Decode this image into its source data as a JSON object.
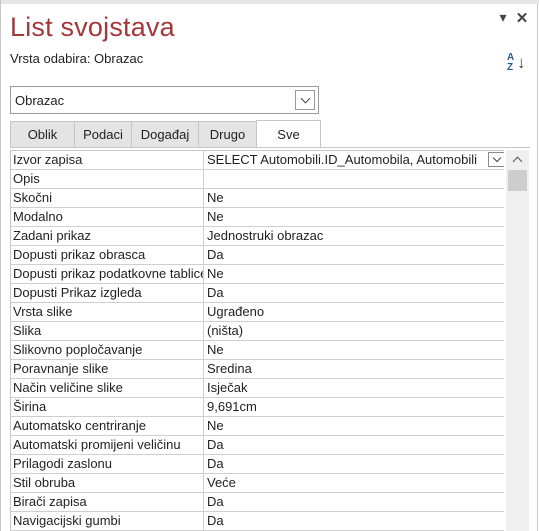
{
  "panel": {
    "title": "List svojstava",
    "selection_type": "Vrsta odabira:  Obrazac",
    "controls": {
      "dropdown_icon": "▾",
      "close_icon": "✕"
    },
    "sort": {
      "a": "A",
      "z": "Z",
      "arrow": "↓"
    }
  },
  "object_selector": {
    "value": "Obrazac"
  },
  "tabs": [
    {
      "label": "Oblik"
    },
    {
      "label": "Podaci"
    },
    {
      "label": "Događaj"
    },
    {
      "label": "Drugo"
    },
    {
      "label": "Sve",
      "active": true
    }
  ],
  "properties": [
    {
      "name": "Izvor zapisa",
      "value": "SELECT Automobili.ID_Automobila, Automobili"
    },
    {
      "name": "Opis",
      "value": ""
    },
    {
      "name": "Skočni",
      "value": "Ne"
    },
    {
      "name": "Modalno",
      "value": "Ne"
    },
    {
      "name": "Zadani prikaz",
      "value": "Jednostruki obrazac"
    },
    {
      "name": "Dopusti prikaz obrasca",
      "value": "Da"
    },
    {
      "name": "Dopusti prikaz podatkovne tablice",
      "value": "Ne"
    },
    {
      "name": "Dopusti Prikaz izgleda",
      "value": "Da"
    },
    {
      "name": "Vrsta slike",
      "value": "Ugrađeno"
    },
    {
      "name": "Slika",
      "value": "(ništa)"
    },
    {
      "name": "Slikovno popločavanje",
      "value": "Ne"
    },
    {
      "name": "Poravnanje slike",
      "value": "Sredina"
    },
    {
      "name": "Način veličine slike",
      "value": "Isječak"
    },
    {
      "name": "Širina",
      "value": "9,691cm"
    },
    {
      "name": "Automatsko centriranje",
      "value": "Ne"
    },
    {
      "name": "Automatski promijeni veličinu",
      "value": "Da"
    },
    {
      "name": "Prilagodi zaslonu",
      "value": "Da"
    },
    {
      "name": "Stil obruba",
      "value": "Veće"
    },
    {
      "name": "Birači zapisa",
      "value": "Da"
    },
    {
      "name": "Navigacijski gumbi",
      "value": "Da"
    }
  ],
  "builder_button": {
    "label": "···"
  }
}
